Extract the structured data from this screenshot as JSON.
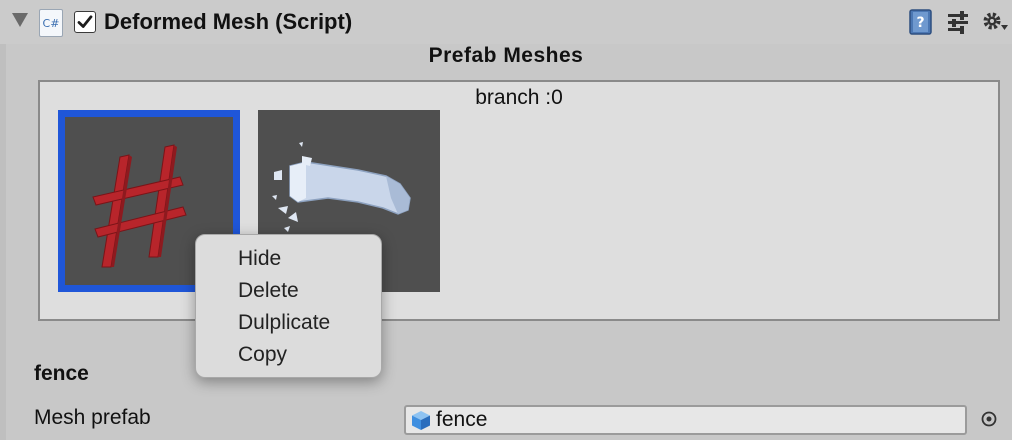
{
  "component": {
    "title": "Deformed Mesh (Script)",
    "script_icon_text": "C#",
    "enabled": true
  },
  "section": {
    "title": "Prefab Meshes"
  },
  "mesh_list": {
    "branch_label": "branch :0",
    "items": [
      {
        "name": "fence",
        "selected": true,
        "icon": "fence-mesh-preview"
      },
      {
        "name": "branch",
        "selected": false,
        "icon": "branch-mesh-preview"
      }
    ]
  },
  "context_menu": {
    "items": [
      "Hide",
      "Delete",
      "Dulplicate",
      "Copy"
    ]
  },
  "selected": {
    "heading": "fence",
    "mesh_prefab_label": "Mesh prefab",
    "mesh_prefab_value": "fence"
  },
  "colors": {
    "selection_border": "#1f56d8",
    "fence_red": "#b8252b",
    "thumb_bg": "#4f4f4f"
  }
}
